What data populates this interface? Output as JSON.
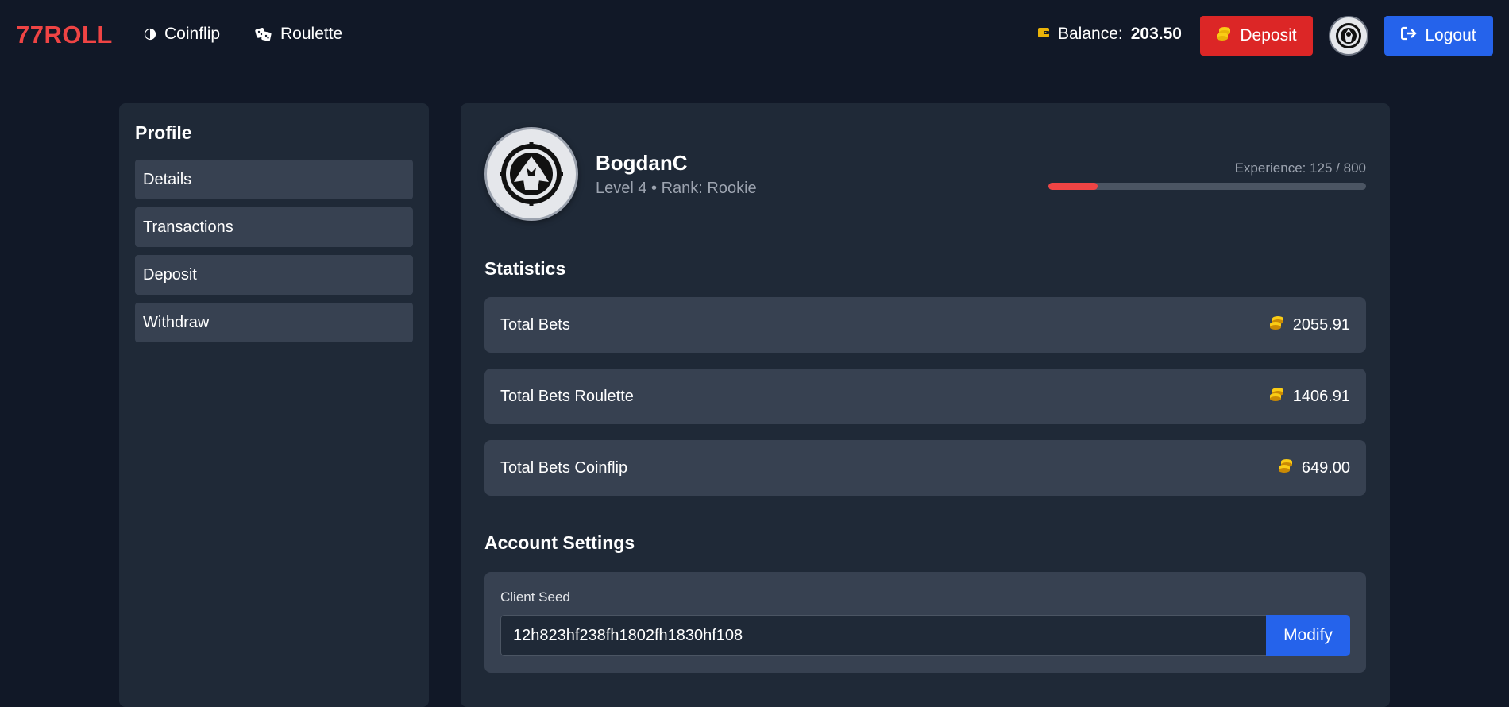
{
  "header": {
    "brand": "77ROLL",
    "nav": [
      {
        "label": "Coinflip",
        "icon": "coinflip-icon"
      },
      {
        "label": "Roulette",
        "icon": "dice-icon"
      }
    ],
    "balance_label": "Balance:",
    "balance_value": "203.50",
    "deposit_label": "Deposit",
    "logout_label": "Logout"
  },
  "sidebar": {
    "title": "Profile",
    "items": [
      {
        "label": "Details"
      },
      {
        "label": "Transactions"
      },
      {
        "label": "Deposit"
      },
      {
        "label": "Withdraw"
      }
    ]
  },
  "profile": {
    "username": "BogdanC",
    "level_rank": "Level 4 • Rank: Rookie",
    "experience_label": "Experience: 125 / 800",
    "experience_fraction": 0.156
  },
  "statistics": {
    "title": "Statistics",
    "rows": [
      {
        "label": "Total Bets",
        "value": "2055.91"
      },
      {
        "label": "Total Bets Roulette",
        "value": "1406.91"
      },
      {
        "label": "Total Bets Coinflip",
        "value": "649.00"
      }
    ]
  },
  "settings": {
    "title": "Account Settings",
    "client_seed_label": "Client Seed",
    "client_seed_value": "12h823hf238fh1802fh1830hf108",
    "modify_label": "Modify"
  },
  "colors": {
    "background": "#111827",
    "panel": "#1f2937",
    "row": "#374151",
    "brand": "#ef4444",
    "deposit": "#dc2626",
    "primary": "#2563eb",
    "coin": "#eab308"
  }
}
